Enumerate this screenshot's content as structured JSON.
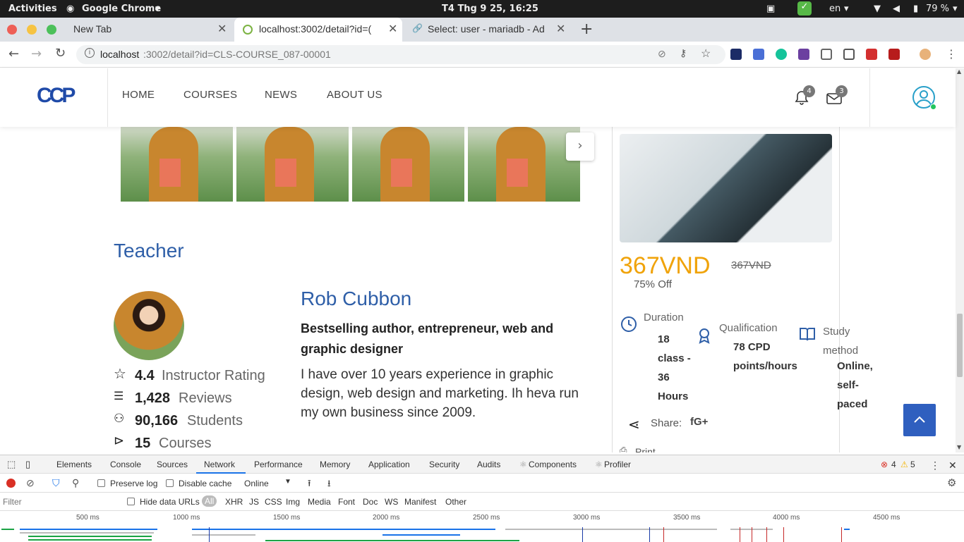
{
  "gnome": {
    "activities": "Activities",
    "app": "Google Chrome",
    "clock": "T4 Thg 9 25, 16:25",
    "lang": "en",
    "battery": "79 %"
  },
  "tabs": [
    {
      "title": "New Tab"
    },
    {
      "title": "localhost:3002/detail?id=("
    },
    {
      "title": "Select: user - mariadb - Ad"
    }
  ],
  "omnibox": {
    "host": "localhost",
    "path": ":3002/detail?id=CLS-COURSE_087-00001"
  },
  "site": {
    "logo": "CCP",
    "nav": [
      "HOME",
      "COURSES",
      "NEWS",
      "ABOUT US"
    ],
    "notifications_count": "4",
    "messages_count": "3"
  },
  "teacher": {
    "section_title": "Teacher",
    "name": "Rob Cubbon",
    "headline": "Bestselling author, entrepreneur, web and graphic designer",
    "bio": "I have over 10 years experience in graphic design, web design and marketing. Ih heva run my own business since 2009.",
    "stats": [
      {
        "icon": "star-icon",
        "value": "4.4",
        "label": "Instructor Rating"
      },
      {
        "icon": "comment-icon",
        "value": "1,428",
        "label": "Reviews"
      },
      {
        "icon": "user-icon",
        "value": "90,166",
        "label": "Students"
      },
      {
        "icon": "play-circle-icon",
        "value": "15",
        "label": "Courses"
      }
    ]
  },
  "course_card": {
    "price": "367VND",
    "old_price": "367VND",
    "discount": "75% Off",
    "duration_label": "Duration",
    "duration_lines": [
      "18",
      "class -",
      "36",
      "Hours"
    ],
    "qualification_label": "Qualification",
    "qualification_lines": [
      "78 CPD",
      "points/hours"
    ],
    "study_label_lines": [
      "Study",
      "method"
    ],
    "study_lines": [
      "Online,",
      "self-",
      "paced"
    ],
    "share_label": "Share:",
    "share_icons": "fG+",
    "print_label": "Print"
  },
  "devtools": {
    "tabs": [
      "Elements",
      "Console",
      "Sources",
      "Network",
      "Performance",
      "Memory",
      "Application",
      "Security",
      "Audits",
      "Components",
      "Profiler"
    ],
    "errors": "4",
    "warnings": "5",
    "preserve_log": "Preserve log",
    "disable_cache": "Disable cache",
    "throttle": "Online",
    "filter_placeholder": "Filter",
    "hide_data_urls": "Hide data URLs",
    "types": [
      "All",
      "XHR",
      "JS",
      "CSS",
      "Img",
      "Media",
      "Font",
      "Doc",
      "WS",
      "Manifest",
      "Other"
    ],
    "timeline": [
      "500 ms",
      "1000 ms",
      "1500 ms",
      "2000 ms",
      "2500 ms",
      "3000 ms",
      "3500 ms",
      "4000 ms",
      "4500 ms"
    ]
  },
  "colors": {
    "brand_blue": "#2f5fa8",
    "price_orange": "#f0a30a",
    "back_to_top": "#2f5fbf"
  }
}
